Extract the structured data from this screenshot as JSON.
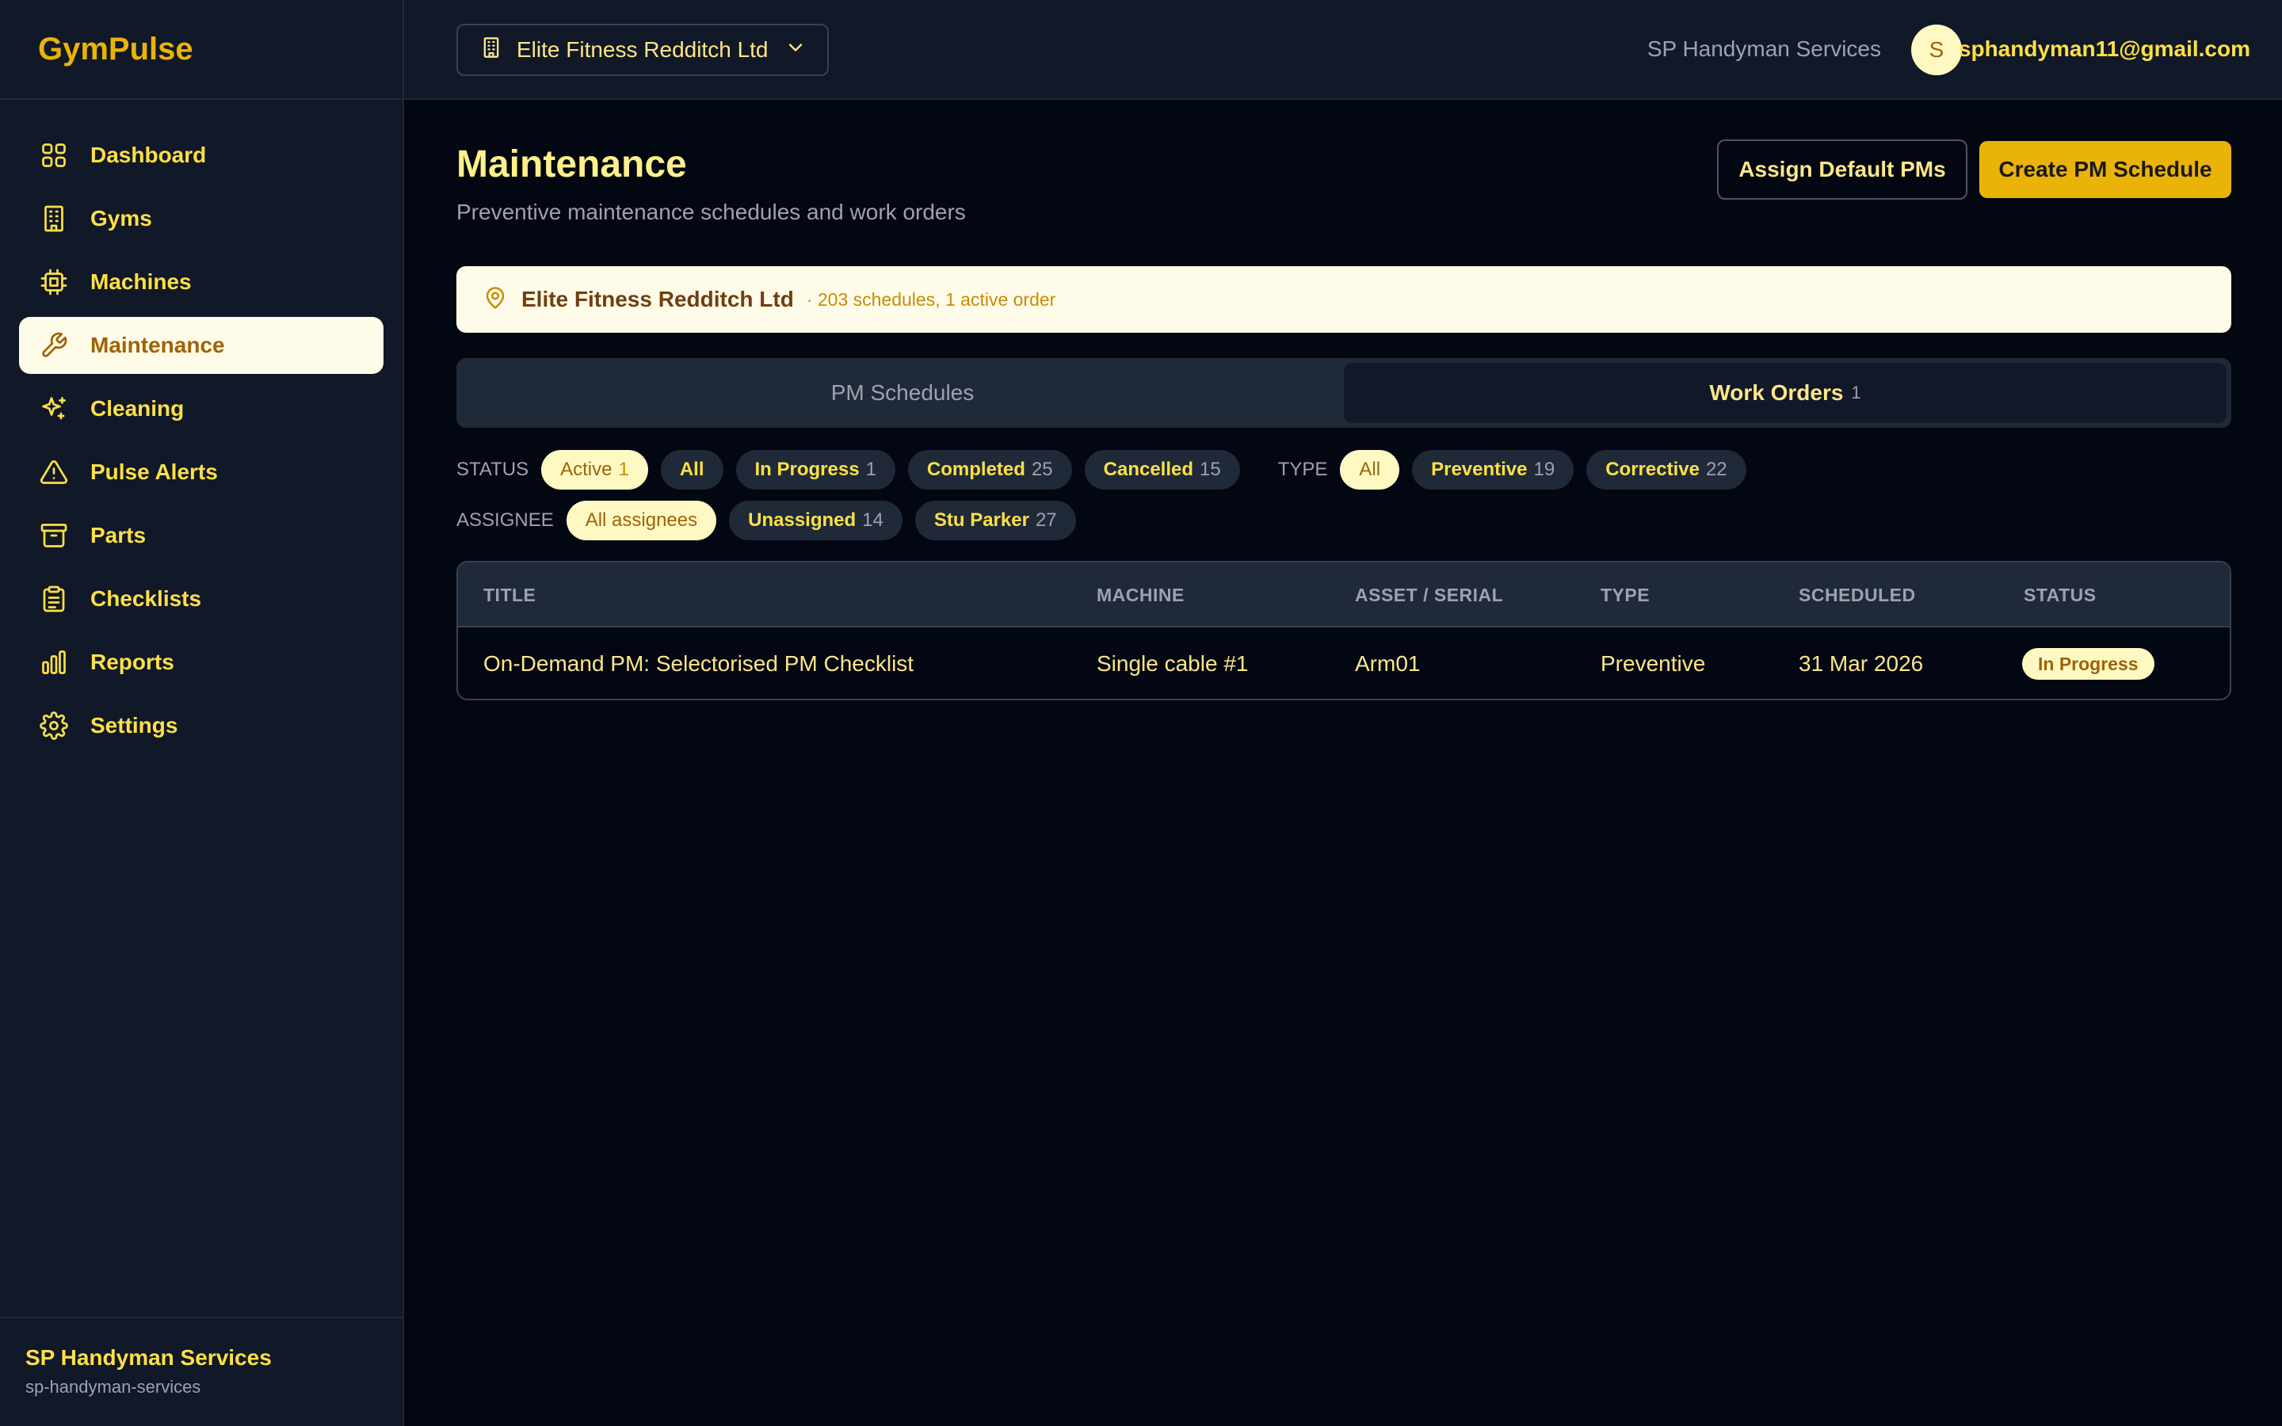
{
  "app": {
    "brand": "GymPulse"
  },
  "sidebar": {
    "items": [
      {
        "label": "Dashboard",
        "icon": "grid-icon"
      },
      {
        "label": "Gyms",
        "icon": "building-icon"
      },
      {
        "label": "Machines",
        "icon": "cpu-icon"
      },
      {
        "label": "Maintenance",
        "icon": "wrench-icon",
        "active": true
      },
      {
        "label": "Cleaning",
        "icon": "sparkles-icon"
      },
      {
        "label": "Pulse Alerts",
        "icon": "alert-triangle-icon"
      },
      {
        "label": "Parts",
        "icon": "archive-icon"
      },
      {
        "label": "Checklists",
        "icon": "clipboard-icon"
      },
      {
        "label": "Reports",
        "icon": "bar-chart-icon"
      },
      {
        "label": "Settings",
        "icon": "gear-icon"
      }
    ],
    "footer": {
      "org_name": "SP Handyman Services",
      "org_slug": "sp-handyman-services"
    }
  },
  "header": {
    "gym_selector": "Elite Fitness Redditch Ltd",
    "org_name": "SP Handyman Services",
    "avatar_initial": "S",
    "email": "sphandyman11@gmail.com"
  },
  "page": {
    "title": "Maintenance",
    "subtitle": "Preventive maintenance schedules and work orders",
    "assign_button": "Assign Default PMs",
    "create_button": "Create PM Schedule"
  },
  "banner": {
    "gym": "Elite Fitness Redditch Ltd",
    "meta": "· 203 schedules, 1 active order"
  },
  "tabs": [
    {
      "label": "PM Schedules",
      "count": ""
    },
    {
      "label": "Work Orders",
      "count": "1",
      "active": true
    }
  ],
  "filters": {
    "status_label": "STATUS",
    "status": [
      {
        "label": "Active",
        "count": "1",
        "selected": true
      },
      {
        "label": "All",
        "count": ""
      },
      {
        "label": "In Progress",
        "count": "1"
      },
      {
        "label": "Completed",
        "count": "25"
      },
      {
        "label": "Cancelled",
        "count": "15"
      }
    ],
    "type_label": "TYPE",
    "type": [
      {
        "label": "All",
        "count": "",
        "selected": true
      },
      {
        "label": "Preventive",
        "count": "19"
      },
      {
        "label": "Corrective",
        "count": "22"
      }
    ],
    "assignee_label": "ASSIGNEE",
    "assignee": [
      {
        "label": "All assignees",
        "count": "",
        "selected": true
      },
      {
        "label": "Unassigned",
        "count": "14"
      },
      {
        "label": "Stu Parker",
        "count": "27"
      }
    ]
  },
  "table": {
    "columns": [
      "TITLE",
      "MACHINE",
      "ASSET / SERIAL",
      "TYPE",
      "SCHEDULED",
      "STATUS"
    ],
    "rows": [
      {
        "title": "On-Demand PM: Selectorised PM Checklist",
        "machine": "Single cable #1",
        "asset": "Arm01",
        "type": "Preventive",
        "scheduled": "31 Mar 2026",
        "status": "In Progress"
      }
    ]
  },
  "colors": {
    "accent": "#eab308",
    "background": "#030712",
    "panel": "#111827",
    "highlight": "#fefce8"
  }
}
